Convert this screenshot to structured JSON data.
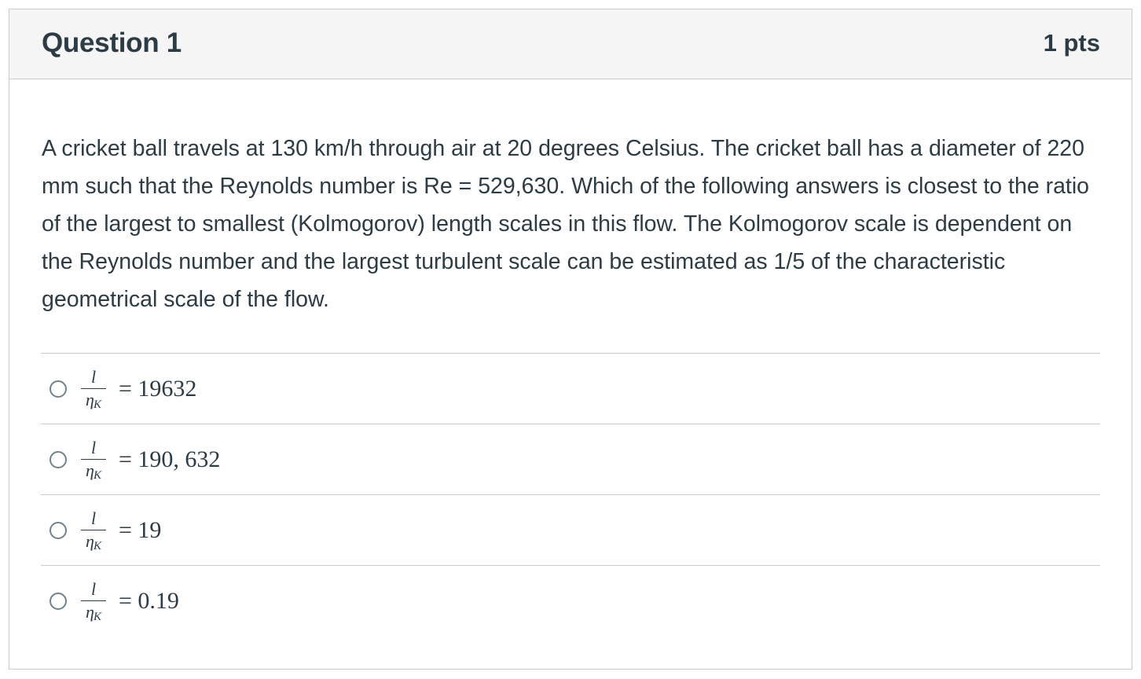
{
  "question": {
    "title": "Question 1",
    "points": "1 pts",
    "text": "A cricket ball travels at 130 km/h through air at 20 degrees Celsius. The cricket ball has a diameter of 220 mm such that the Reynolds number is Re = 529,630. Which of the following answers is closest to the ratio of the largest to smallest (Kolmogorov) length scales in this flow. The Kolmogorov scale is dependent on the Reynolds number and the largest turbulent scale can be estimated as 1/5 of the  characteristic geometrical scale of the flow."
  },
  "answers": [
    {
      "numerator": "l",
      "denominator": "η",
      "denominator_sub": "K",
      "value": "= 19632",
      "selected": false
    },
    {
      "numerator": "l",
      "denominator": "η",
      "denominator_sub": "K",
      "value": "= 190, 632",
      "selected": false
    },
    {
      "numerator": "l",
      "denominator": "η",
      "denominator_sub": "K",
      "value": "= 19",
      "selected": false
    },
    {
      "numerator": "l",
      "denominator": "η",
      "denominator_sub": "K",
      "value": "= 0.19",
      "selected": false
    }
  ]
}
